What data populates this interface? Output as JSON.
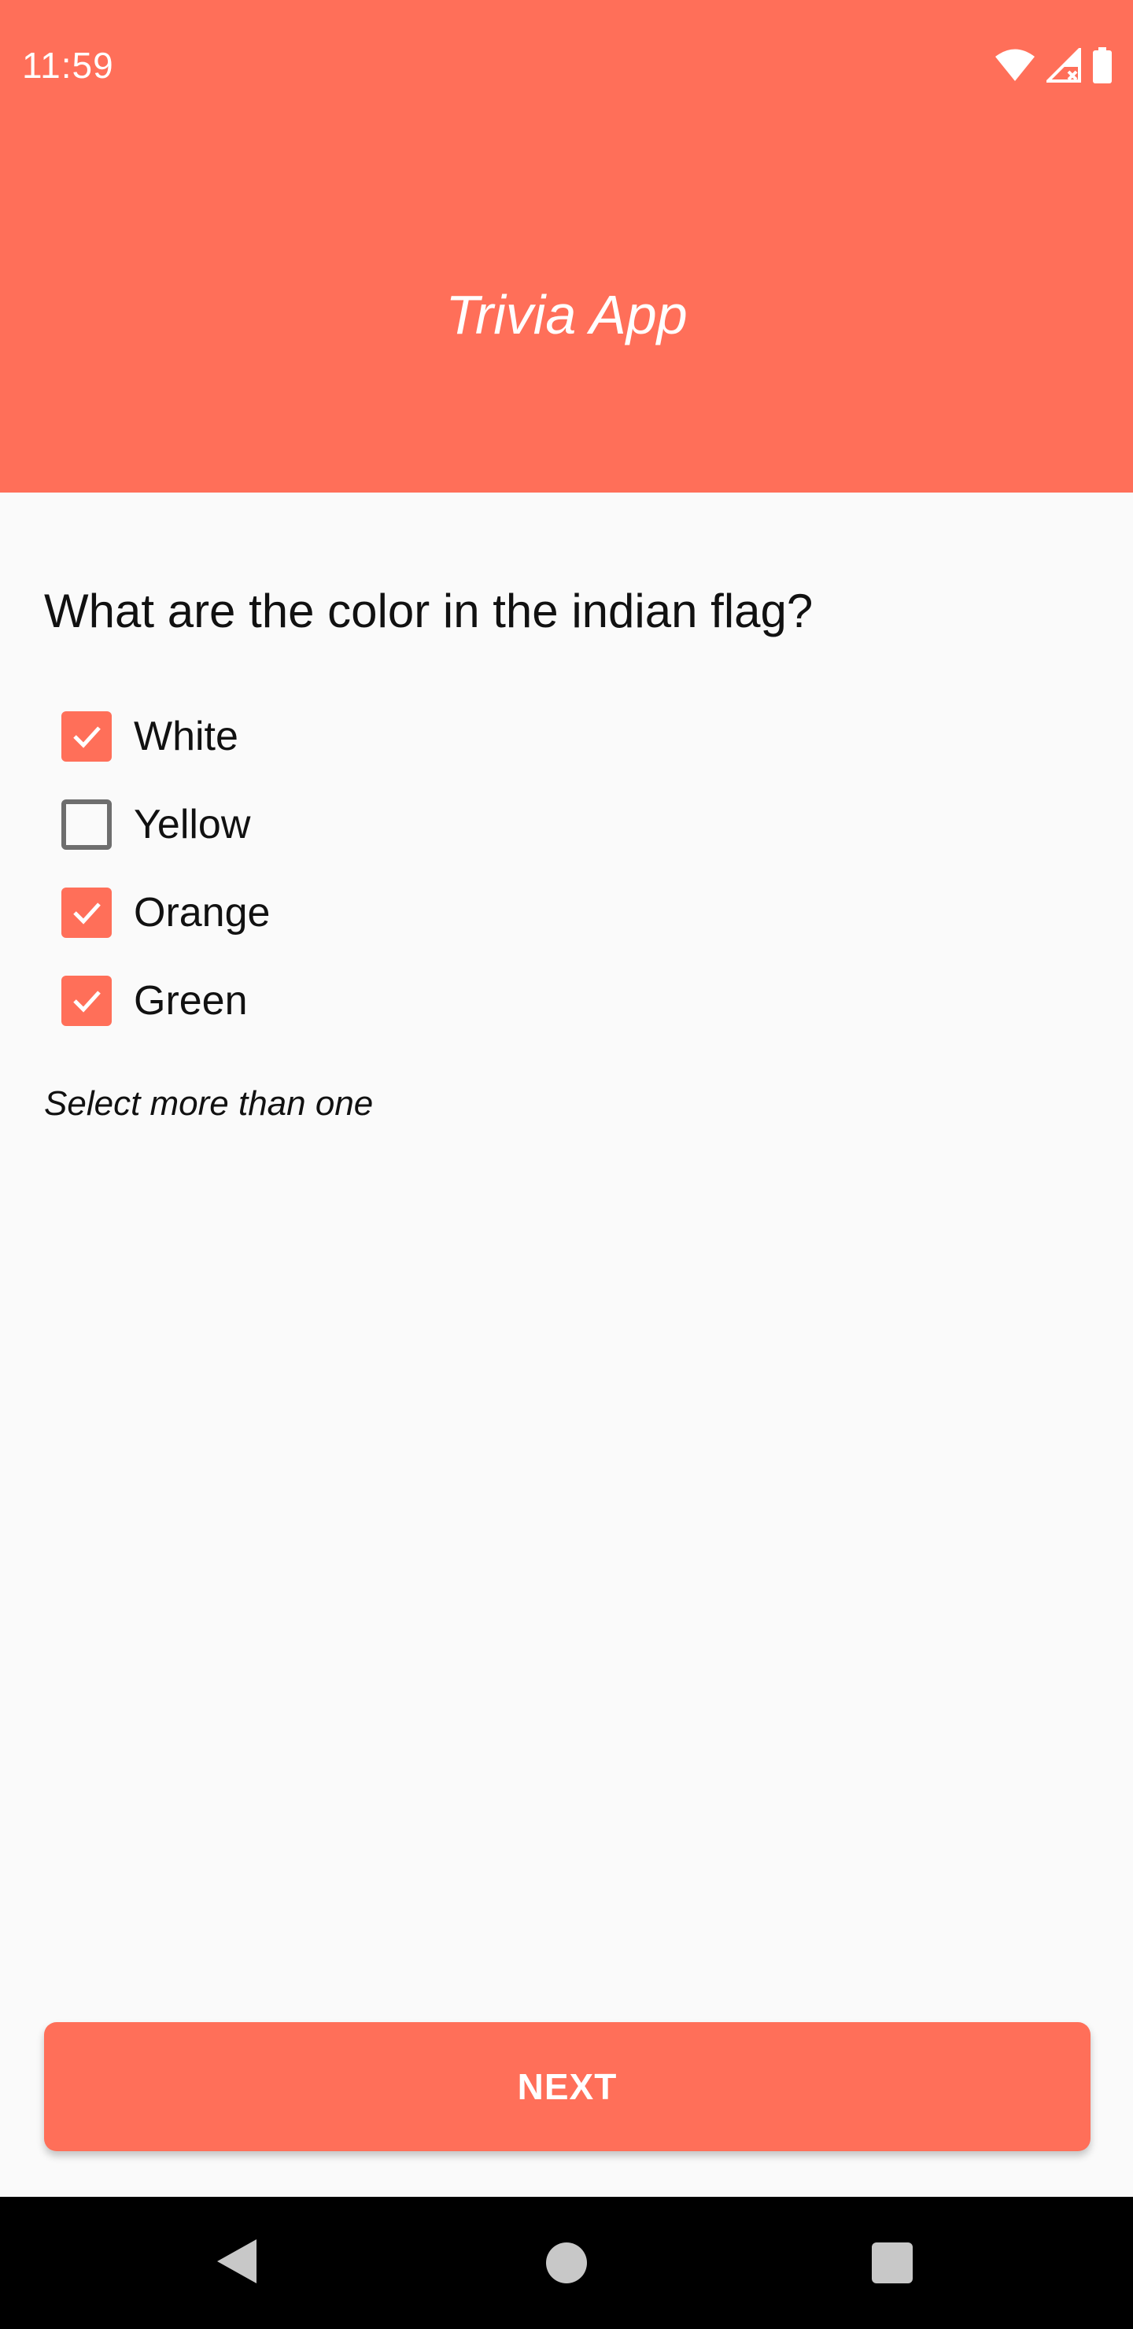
{
  "status_bar": {
    "time": "11:59",
    "icons": [
      "wifi-icon",
      "signal-icon",
      "battery-icon"
    ]
  },
  "header": {
    "title": "Trivia App",
    "background_color": "#ff6f59"
  },
  "quiz": {
    "question": "What are the color in the indian flag?",
    "options": [
      {
        "label": "White",
        "checked": true
      },
      {
        "label": "Yellow",
        "checked": false
      },
      {
        "label": "Orange",
        "checked": true
      },
      {
        "label": "Green",
        "checked": true
      }
    ],
    "hint": "Select more than one"
  },
  "actions": {
    "next_label": "NEXT"
  },
  "nav_bar": {
    "buttons": [
      "back-icon",
      "home-icon",
      "recents-icon"
    ]
  },
  "colors": {
    "accent": "#ff6f59",
    "background": "#fafafa",
    "checkbox_unchecked": "#6e6e6e"
  }
}
